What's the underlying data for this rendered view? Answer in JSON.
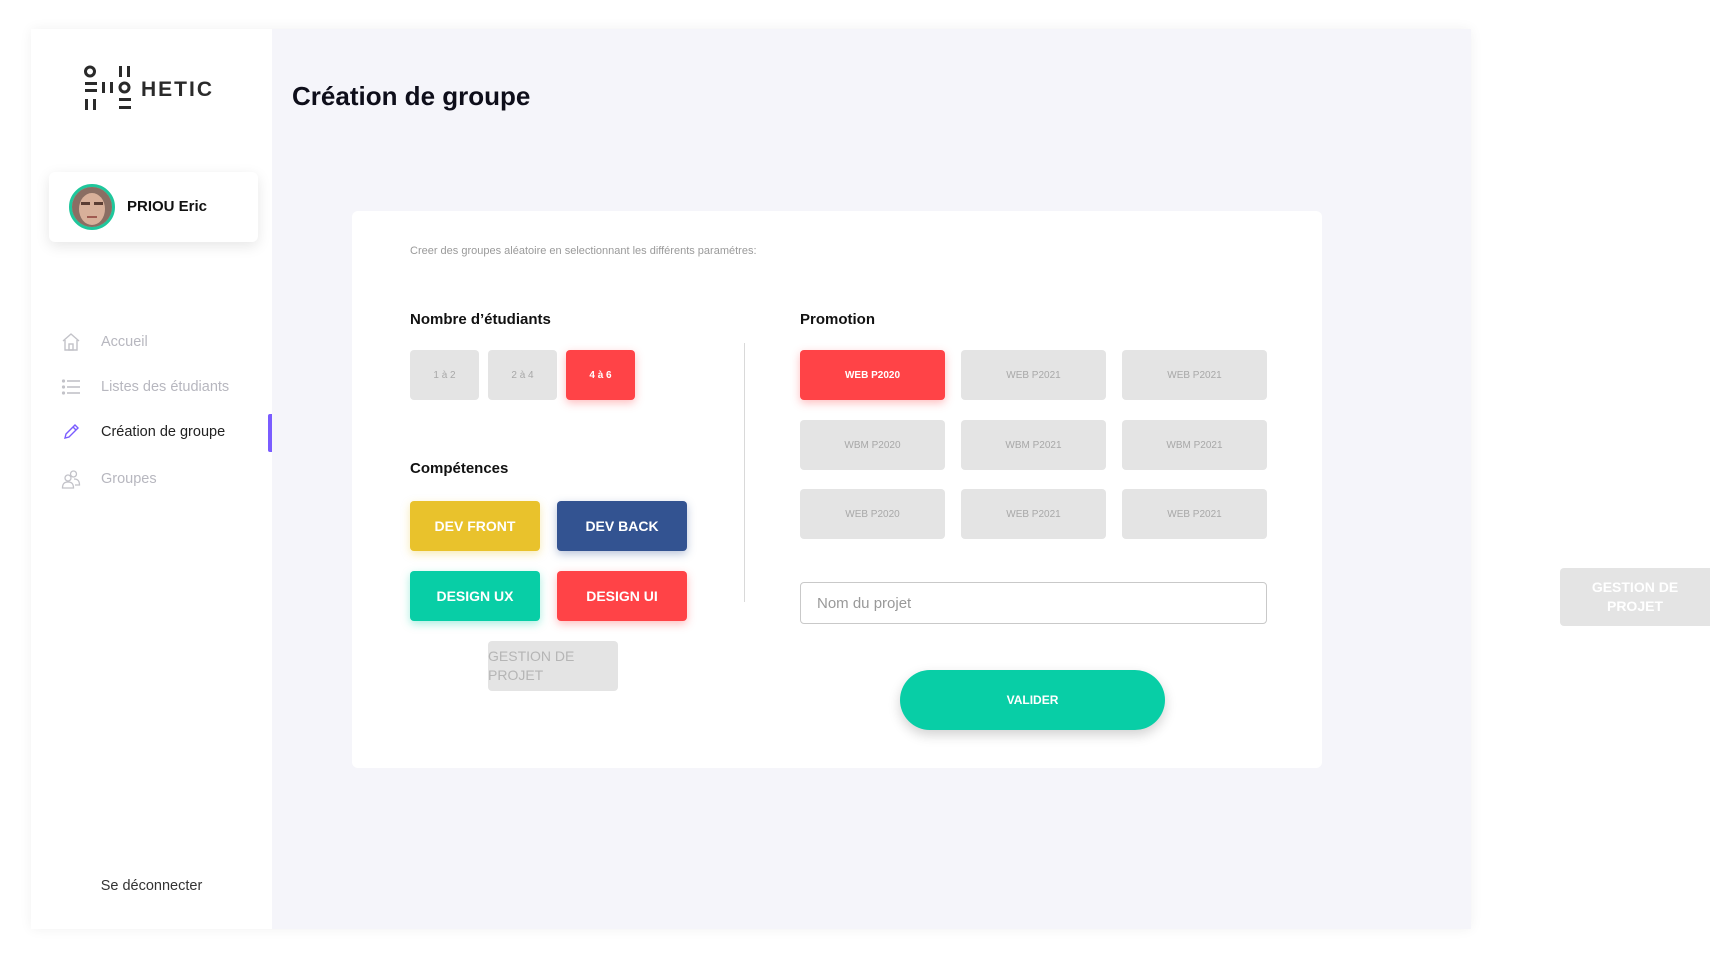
{
  "brand": {
    "name": "HETIC"
  },
  "user": {
    "name": "PRIOU Eric"
  },
  "sidebar": {
    "items": [
      {
        "label": "Accueil",
        "icon": "home-icon",
        "active": false
      },
      {
        "label": "Listes des étudiants",
        "icon": "list-icon",
        "active": false
      },
      {
        "label": "Création de groupe",
        "icon": "pencil-icon",
        "active": true
      },
      {
        "label": "Groupes",
        "icon": "users-icon",
        "active": false
      }
    ],
    "logout_label": "Se déconnecter"
  },
  "page": {
    "title": "Création de groupe"
  },
  "form": {
    "instruction": "Creer des groupes aléatoire en selectionnant les différents paramétres:",
    "students_label": "Nombre d’étudiants",
    "student_counts": [
      {
        "label": "1 à 2",
        "selected": false
      },
      {
        "label": "2 à 4",
        "selected": false
      },
      {
        "label": "4 à 6",
        "selected": true
      }
    ],
    "skills_label": "Compétences",
    "skills": [
      {
        "label": "DEV FRONT",
        "color": "#e9c22c",
        "selected": true
      },
      {
        "label": "DEV BACK",
        "color": "#335391",
        "selected": true
      },
      {
        "label": "DESIGN UX",
        "color": "#08cea6",
        "selected": true
      },
      {
        "label": "DESIGN UI",
        "color": "#ff4347",
        "selected": true
      },
      {
        "label": "GESTION DE PROJET",
        "color": "#e4e4e4",
        "selected": false
      }
    ],
    "promotion_label": "Promotion",
    "promotions": [
      {
        "label": "WEB P2020",
        "selected": true
      },
      {
        "label": "WEB P2021",
        "selected": false
      },
      {
        "label": "WEB P2021",
        "selected": false
      },
      {
        "label": "WBM P2020",
        "selected": false
      },
      {
        "label": "WBM P2021",
        "selected": false
      },
      {
        "label": "WBM P2021",
        "selected": false
      },
      {
        "label": "WEB P2020",
        "selected": false
      },
      {
        "label": "WEB P2021",
        "selected": false
      },
      {
        "label": "WEB P2021",
        "selected": false
      }
    ],
    "project_placeholder": "Nom du projet",
    "project_value": "",
    "submit_label": "VALIDER"
  },
  "floating_chip": {
    "label": "GESTION DE PROJET"
  },
  "colors": {
    "accent": "#7a5cff",
    "selected": "#ff4347",
    "primary_button": "#08cea6",
    "background": "#f5f5fa"
  }
}
